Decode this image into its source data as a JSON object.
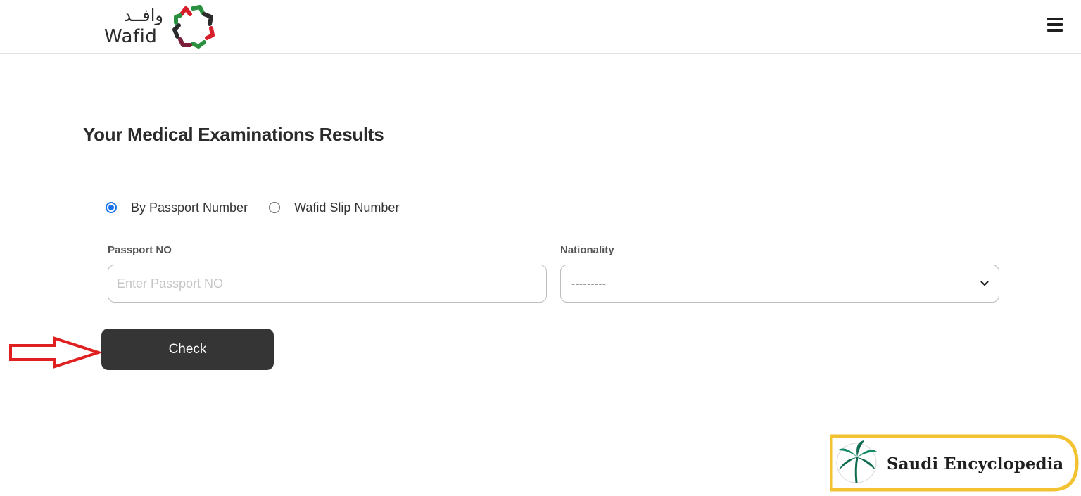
{
  "header": {
    "logo_arabic": "وافــد",
    "logo_english": "Wafid",
    "menu_icon": "hamburger-menu-icon"
  },
  "main": {
    "title": "Your Medical Examinations Results",
    "search_options": [
      {
        "label": "By Passport Number",
        "checked": true
      },
      {
        "label": "Wafid Slip Number",
        "checked": false
      }
    ],
    "passport": {
      "label": "Passport NO",
      "placeholder": "Enter Passport NO",
      "value": ""
    },
    "nationality": {
      "label": "Nationality",
      "selected": "---------"
    },
    "check_button": "Check"
  },
  "annotation": {
    "arrow_color": "#e02020",
    "arrow_icon": "right-arrow-icon"
  },
  "watermark": {
    "text": "Saudi Encyclopedia",
    "border_color": "#f2c230",
    "icon": "palm-globe-icon"
  },
  "colors": {
    "accent": "#1a73e8",
    "button_bg": "#353535"
  }
}
